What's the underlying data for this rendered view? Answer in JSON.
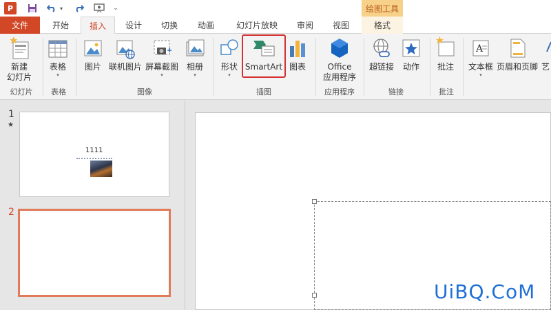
{
  "title_bar": {
    "app_logo": "P",
    "context_tools_label": "绘图工具"
  },
  "tabs": {
    "file": "文件",
    "home": "开始",
    "insert": "插入",
    "design": "设计",
    "transitions": "切换",
    "animations": "动画",
    "slideshow": "幻灯片放映",
    "review": "审阅",
    "view": "视图",
    "format": "格式"
  },
  "ribbon": {
    "new_slide": {
      "line1": "新建",
      "line2": "幻灯片"
    },
    "table": "表格",
    "pictures": "图片",
    "online_pictures": "联机图片",
    "screenshot": "屏幕截图",
    "photo_album": "相册",
    "shapes": "形状",
    "smartart": "SmartArt",
    "chart": "图表",
    "office_apps": {
      "line1": "Office",
      "line2": "应用程序"
    },
    "hyperlink": "超链接",
    "action": "动作",
    "comment": "批注",
    "text_box": "文本框",
    "header_footer": "页眉和页脚",
    "art": "艺"
  },
  "groups": {
    "slides": "幻灯片",
    "tables": "表格",
    "images": "图像",
    "illustrations": "插图",
    "apps": "应用程序",
    "links": "链接",
    "comments": "批注"
  },
  "thumbnails": [
    {
      "number": "1",
      "star": "★",
      "text": "1111"
    },
    {
      "number": "2"
    }
  ],
  "watermark": "UiBQ.CoM",
  "colors": {
    "accent": "#d24726",
    "highlight": "#d33030",
    "context_tab": "#f7d089"
  },
  "icons": {
    "save": "save-icon",
    "undo": "undo-icon",
    "redo": "redo-icon",
    "present": "present-icon"
  }
}
